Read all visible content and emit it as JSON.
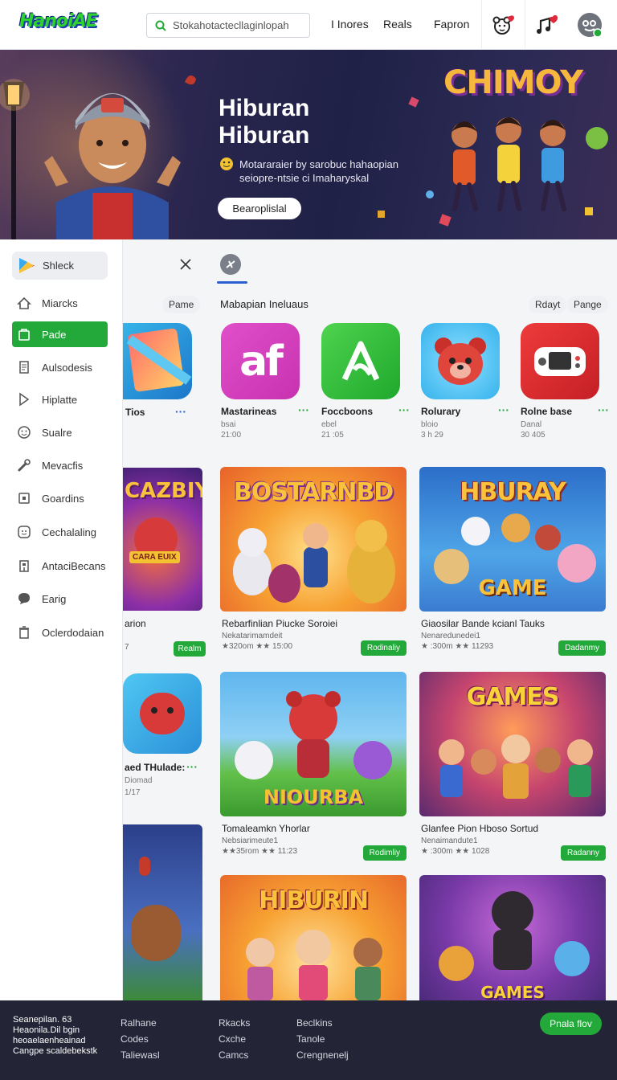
{
  "header": {
    "logo": "HanoiAE",
    "search_placeholder": "Stokahotactecllaginlopah",
    "nav": [
      "I Inores",
      "Reals",
      "Fapron"
    ]
  },
  "hero": {
    "title_line1": "Hiburan",
    "title_line2": "Hiburan",
    "description": "Motararaier by sarobuc hahaopian seiopre-ntsie ci Imaharyskal",
    "button": "Bearoplislal",
    "badge": "CHIMOY"
  },
  "sidebar": {
    "search_label": "Shleck",
    "items": [
      {
        "label": "Miarcks",
        "icon": "home-icon"
      },
      {
        "label": "Pade",
        "icon": "bag-icon"
      },
      {
        "label": "Aulsodesis",
        "icon": "doc-icon"
      },
      {
        "label": "Hiplatte",
        "icon": "arrow-icon"
      },
      {
        "label": "Sualre",
        "icon": "smile-icon"
      },
      {
        "label": "Mevacfis",
        "icon": "wrench-icon"
      },
      {
        "label": "Goardins",
        "icon": "box-icon"
      },
      {
        "label": "Cechalaling",
        "icon": "face-icon"
      },
      {
        "label": "AntaciBecans",
        "icon": "building-icon"
      },
      {
        "label": "Earig",
        "icon": "chat-icon"
      },
      {
        "label": "Oclerdodaian",
        "icon": "trash-icon"
      }
    ]
  },
  "behind_panel": {
    "chip": "Pame",
    "app_name": "Tios",
    "card1_title": "arion",
    "card1_meta": "7",
    "card1_btn": "Realm",
    "card1_banner": "CAZBIY",
    "card1_sign": "CARA EUIX",
    "app2_name": "aed THulade:",
    "app2_sub1": "Diomad",
    "app2_sub2": "1/17"
  },
  "main": {
    "section_title": "Mabapian Ineluaus",
    "chips": [
      "Rdayt",
      "Pange"
    ],
    "apps": [
      {
        "name": "Mastarineas",
        "sub1": "bsai",
        "sub2": "21:00",
        "tile_text": "af"
      },
      {
        "name": "Foccboons",
        "sub1": "ebel",
        "sub2": "21 :05",
        "tile_text": ""
      },
      {
        "name": "Rolurary",
        "sub1": "bloio",
        "sub2": "3 h 29",
        "tile_text": ""
      },
      {
        "name": "Rolne base",
        "sub1": "Danal",
        "sub2": "30 405",
        "tile_text": ""
      }
    ],
    "cards": [
      {
        "title": "Rebarfinlian Piucke Soroiei",
        "meta1": "Nekatarimamdeit",
        "meta2": "★320om ★★ 15:00",
        "btn": "Rodinaliy",
        "banner": "BOSTARNBD"
      },
      {
        "title": "Giaosilar Bande kcianl Tauks",
        "meta1": "Nenaredunedei1",
        "meta2": "★ :300m ★★ 11293",
        "btn": "Dadanmy",
        "banner": "HBURAY"
      },
      {
        "title": "Tomaleamkn Yhorlar",
        "meta1": "Nebsiarimeute1",
        "meta2": "★★35rom ★★ 11:23",
        "btn": "Rodimliy",
        "banner": "NIOURBA"
      },
      {
        "title": "Glanfee Pion Hboso Sortud",
        "meta1": "Nenaimandute1",
        "meta2": "★ :300m ★★ 1028",
        "btn": "Radanny",
        "banner": "GAMES"
      },
      {
        "title": "",
        "meta1": "",
        "meta2": "",
        "btn": "",
        "banner": "HIBURIN"
      },
      {
        "title": "",
        "meta1": "",
        "meta2": "",
        "btn": "",
        "banner": "GAMES"
      }
    ],
    "card2_sub_banner": "GAME"
  },
  "footer": {
    "about": "Seanepilan. 63 Heaonila.Dil bgin heoaelaenheainad Cangpe scaldebekstk",
    "col1": [
      "Ralhane",
      "Codes",
      "Taliewasl"
    ],
    "col2": [
      "Rkacks",
      "Cxche",
      "Camcs"
    ],
    "col3": [
      "Beclkins",
      "Tanole",
      "Crengnenelj"
    ],
    "cta": "Pnala flov"
  },
  "colors": {
    "accent_green": "#22a93a",
    "tab_blue": "#2d5fd1",
    "footer_bg": "#232436"
  }
}
